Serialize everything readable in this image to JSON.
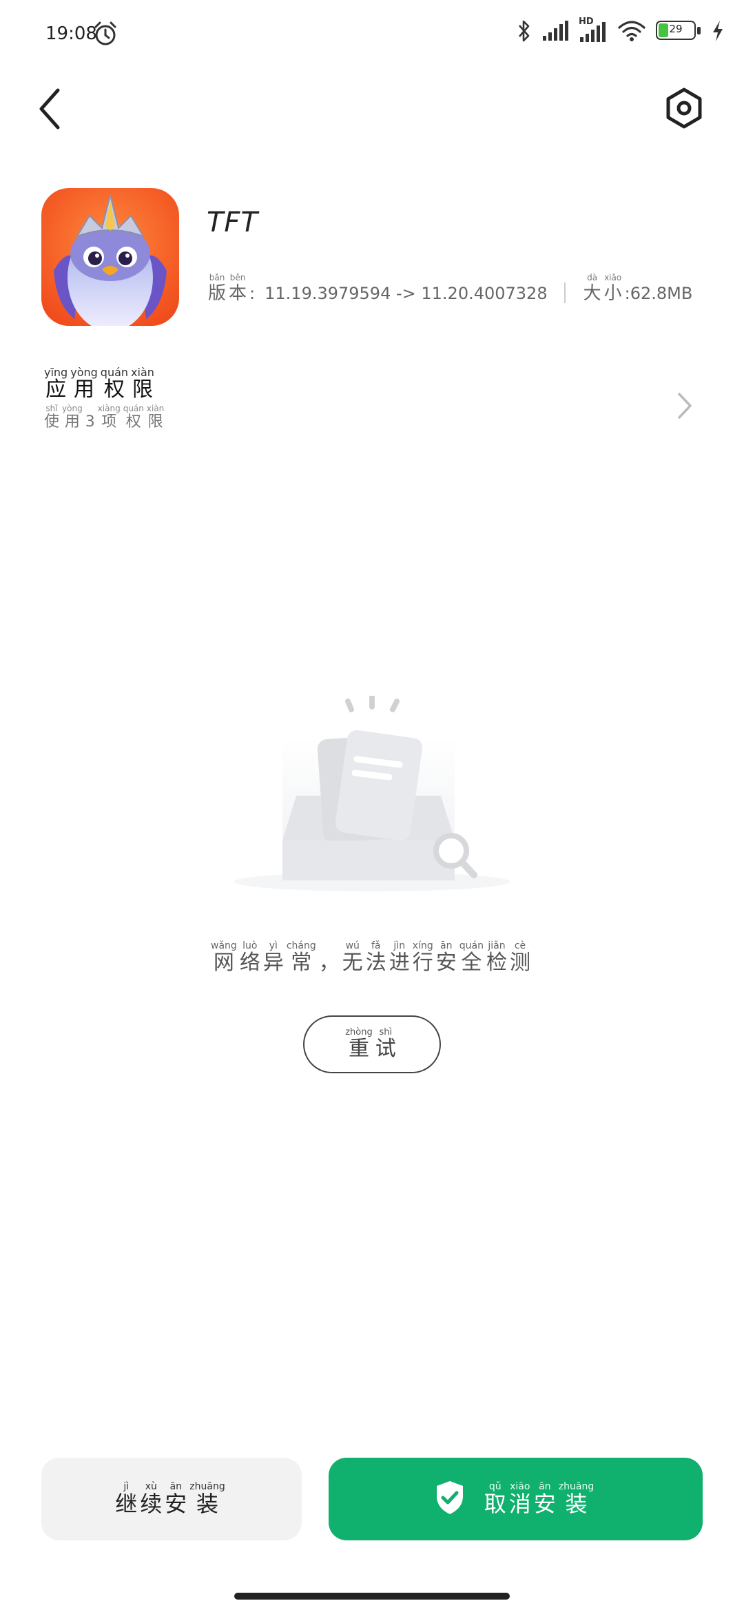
{
  "status_bar": {
    "time": "19:08",
    "battery_percent": "29",
    "battery_level": 0.29,
    "network_label": "HD",
    "icons": [
      "alarm-icon",
      "bluetooth-icon",
      "signal-icon",
      "hd-signal-icon",
      "wifi-icon",
      "battery-icon",
      "charging-icon"
    ]
  },
  "header": {
    "back_icon": "chevron-left-icon",
    "settings_icon": "settings-hexagon-icon"
  },
  "app": {
    "name": "TFT",
    "version_label": [
      {
        "py": "bǎn",
        "hz": "版"
      },
      {
        "py": "běn",
        "hz": "本"
      }
    ],
    "version_value": "11.19.3979594 -> 11.20.4007328",
    "size_label": [
      {
        "py": "dà",
        "hz": "大"
      },
      {
        "py": "xiǎo",
        "hz": "小"
      }
    ],
    "size_value": ":62.8MB"
  },
  "permissions": {
    "title": [
      {
        "py": "yīng",
        "hz": "应"
      },
      {
        "py": "yòng",
        "hz": "用"
      },
      {
        "py": "quán",
        "hz": "权"
      },
      {
        "py": "xiàn",
        "hz": "限"
      }
    ],
    "subtitle": [
      {
        "py": "shǐ",
        "hz": "使"
      },
      {
        "py": "yòng",
        "hz": "用"
      },
      {
        "py": "",
        "hz": "3"
      },
      {
        "py": "xiàng",
        "hz": "项"
      },
      {
        "py": "quán",
        "hz": "权"
      },
      {
        "py": "xiàn",
        "hz": "限"
      }
    ]
  },
  "empty_state": {
    "message": [
      {
        "py": "wǎng",
        "hz": "网"
      },
      {
        "py": "luò",
        "hz": "络"
      },
      {
        "py": "yì",
        "hz": "异"
      },
      {
        "py": "cháng",
        "hz": "常"
      },
      {
        "py": "",
        "hz": "，"
      },
      {
        "py": "wú",
        "hz": "无"
      },
      {
        "py": "fǎ",
        "hz": "法"
      },
      {
        "py": "jìn",
        "hz": "进"
      },
      {
        "py": "xíng",
        "hz": "行"
      },
      {
        "py": "ān",
        "hz": "安"
      },
      {
        "py": "quán",
        "hz": "全"
      },
      {
        "py": "jiǎn",
        "hz": "检"
      },
      {
        "py": "cè",
        "hz": "测"
      }
    ],
    "retry": [
      {
        "py": "zhòng",
        "hz": "重"
      },
      {
        "py": "shì",
        "hz": "试"
      }
    ]
  },
  "actions": {
    "continue": [
      {
        "py": "jì",
        "hz": "继"
      },
      {
        "py": "xù",
        "hz": "续"
      },
      {
        "py": "ān",
        "hz": "安"
      },
      {
        "py": "zhuāng",
        "hz": "装"
      }
    ],
    "cancel": [
      {
        "py": "qǔ",
        "hz": "取"
      },
      {
        "py": "xiāo",
        "hz": "消"
      },
      {
        "py": "ān",
        "hz": "安"
      },
      {
        "py": "zhuāng",
        "hz": "装"
      }
    ],
    "cancel_icon": "shield-check-icon"
  },
  "colors": {
    "primary_green": "#10b06e",
    "battery_green": "#45c241",
    "secondary_button": "#f2f2f2"
  }
}
